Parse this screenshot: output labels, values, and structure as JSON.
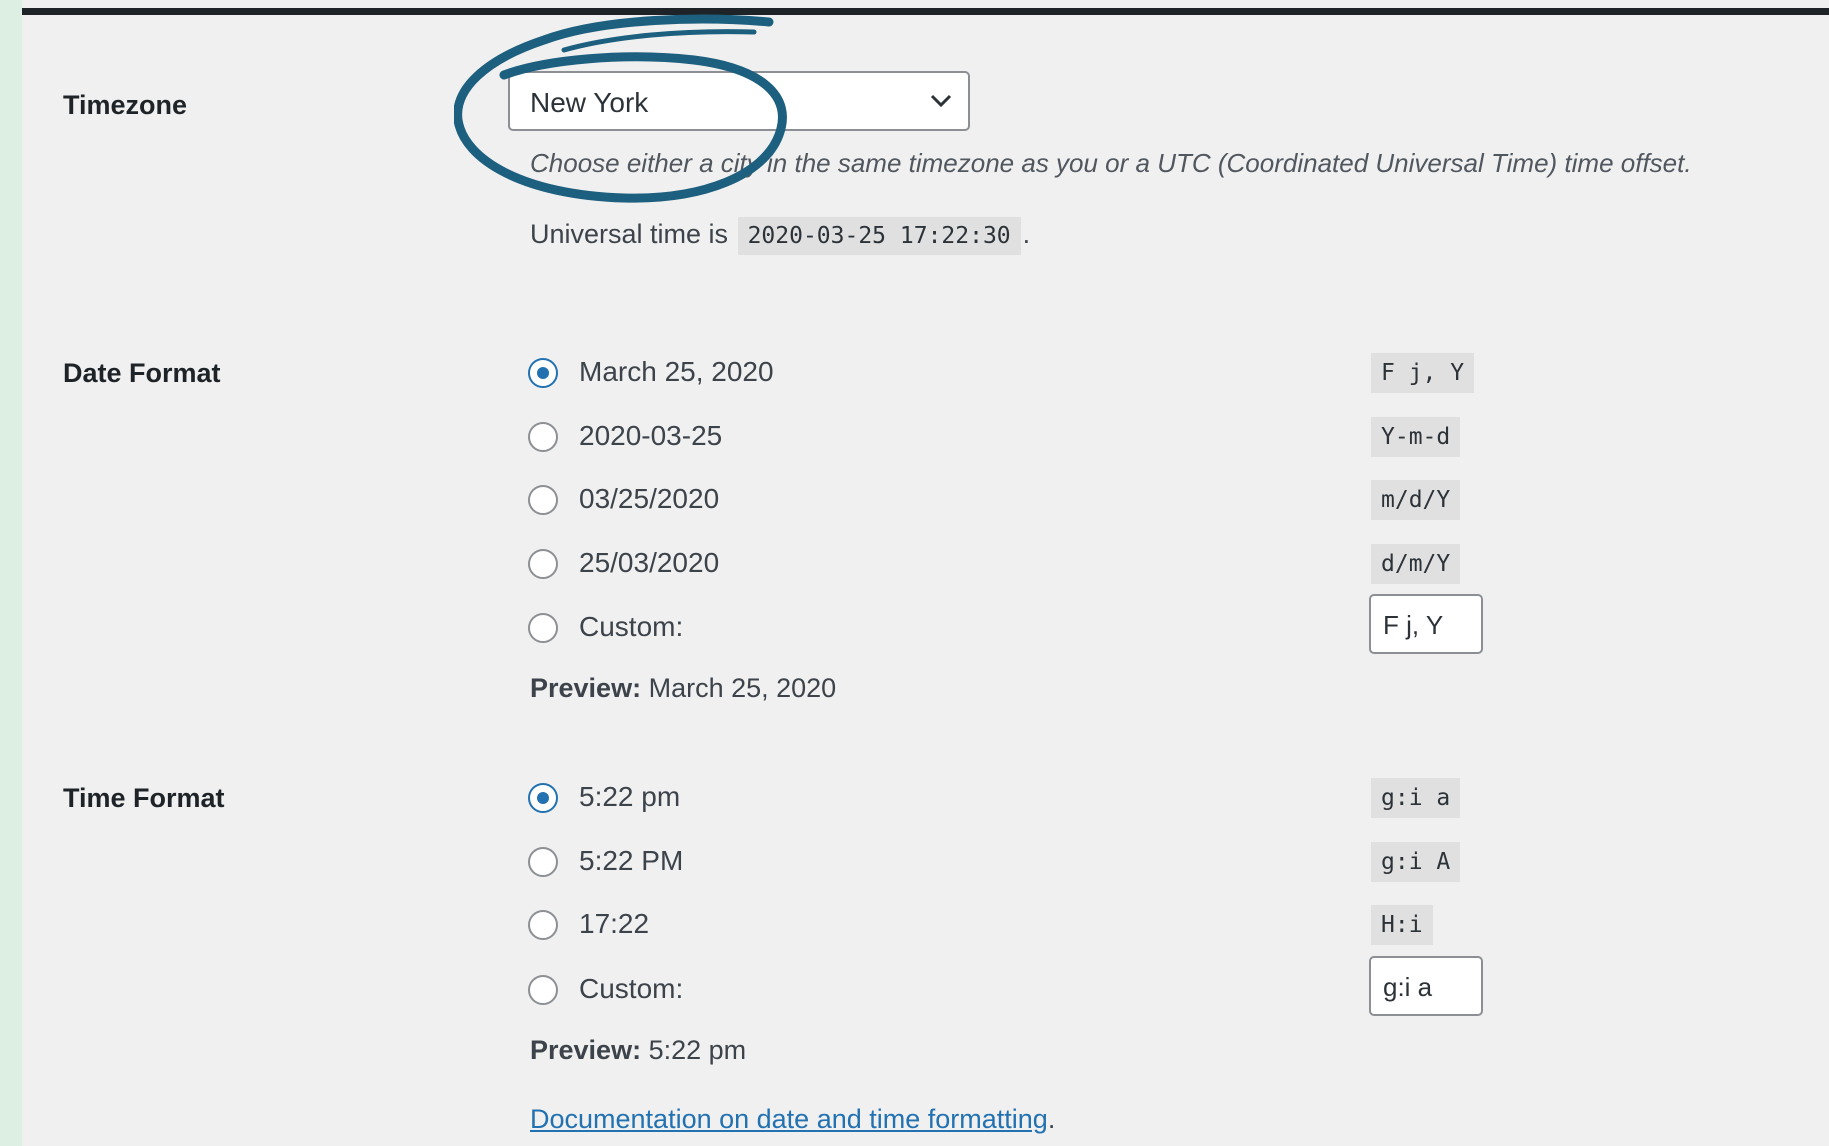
{
  "timezone": {
    "label": "Timezone",
    "selected": "New York",
    "description": "Choose either a city in the same timezone as you or a UTC (Coordinated Universal Time) time offset.",
    "universal_prefix": "Universal time is",
    "universal_value": "2020-03-25 17:22:30",
    "universal_suffix": "."
  },
  "date_format": {
    "label": "Date Format",
    "options": [
      {
        "label": "March 25, 2020",
        "code": "F j, Y",
        "checked": true
      },
      {
        "label": "2020-03-25",
        "code": "Y-m-d",
        "checked": false
      },
      {
        "label": "03/25/2020",
        "code": "m/d/Y",
        "checked": false
      },
      {
        "label": "25/03/2020",
        "code": "d/m/Y",
        "checked": false
      }
    ],
    "custom_label": "Custom:",
    "custom_value": "F j, Y",
    "preview_label": "Preview:",
    "preview_value": "March 25, 2020"
  },
  "time_format": {
    "label": "Time Format",
    "options": [
      {
        "label": "5:22 pm",
        "code": "g:i a",
        "checked": true
      },
      {
        "label": "5:22 PM",
        "code": "g:i A",
        "checked": false
      },
      {
        "label": "17:22",
        "code": "H:i",
        "checked": false
      }
    ],
    "custom_label": "Custom:",
    "custom_value": "g:i a",
    "preview_label": "Preview:",
    "preview_value": "5:22 pm"
  },
  "documentation": {
    "link_text": "Documentation on date and time formatting",
    "suffix": "."
  },
  "colors": {
    "accent": "#2271b1",
    "annotation": "#1d5f7e",
    "panel": "#f0f0f1",
    "frame": "#ddeee2"
  }
}
